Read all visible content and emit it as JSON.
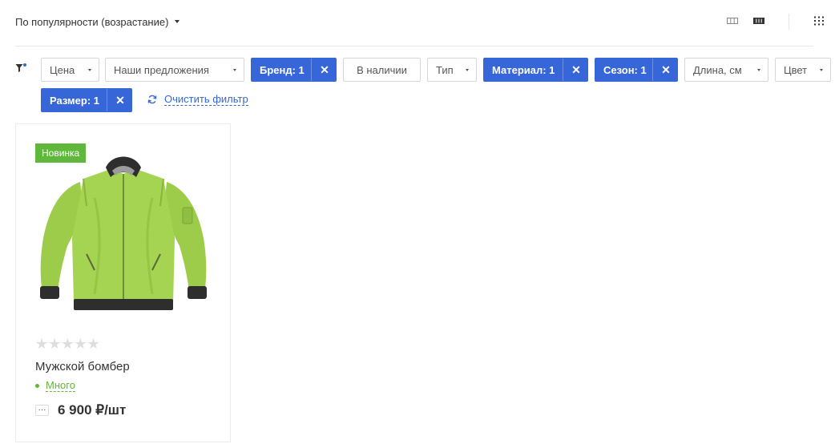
{
  "sort": {
    "label": "По популярности (возрастание)"
  },
  "filters": {
    "price": "Цена",
    "offers": "Наши предложения",
    "brand": "Бренд: 1",
    "in_stock": "В наличии",
    "type": "Тип",
    "material": "Материал: 1",
    "season": "Сезон: 1",
    "length": "Длина, см",
    "color": "Цвет",
    "size": "Размер: 1",
    "remove_glyph": "✕",
    "clear": "Очистить фильтр"
  },
  "product": {
    "badge": "Новинка",
    "rating_stars": "★★★★★",
    "rating_value": 0,
    "title": "Мужской бомбер",
    "stock": "Много",
    "more": "···",
    "price": "6 900 ₽/шт"
  },
  "colors": {
    "accent": "#3766d8",
    "badge_green": "#5fb83b",
    "jacket_green": "#9dcc4a"
  }
}
